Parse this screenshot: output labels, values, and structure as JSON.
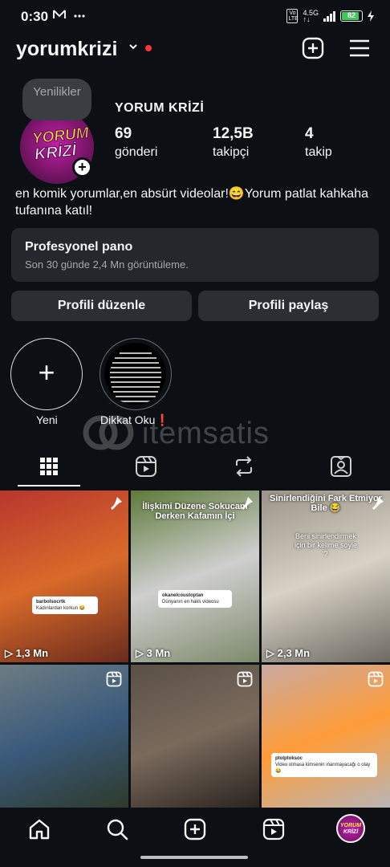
{
  "status_bar": {
    "time": "0:30",
    "network": "4.5G",
    "battery": "82",
    "battery_level": 0.82
  },
  "header": {
    "username": "yorumkrizi"
  },
  "profile": {
    "note": "Yenilikler",
    "display_name": "YORUM KRİZİ",
    "avatar_text_top": "YORUM",
    "avatar_text_bottom": "KRİZİ",
    "stats": [
      {
        "value": "69",
        "label": "gönderi"
      },
      {
        "value": "12,5B",
        "label": "takipçi"
      },
      {
        "value": "4",
        "label": "takip"
      }
    ],
    "bio": "en komik yorumlar,en absürt videolar!😄Yorum patlat kahkaha tufanına katıl!"
  },
  "professional_dashboard": {
    "title": "Profesyonel pano",
    "subtitle": "Son 30 günde 2,4 Mn görüntüleme."
  },
  "actions": {
    "edit_profile": "Profili düzenle",
    "share_profile": "Profili paylaş"
  },
  "highlights": [
    {
      "label": "Yeni",
      "symbol": "+"
    },
    {
      "label": "Dikkat Oku❗"
    }
  ],
  "watermark": {
    "text": "itemsatis"
  },
  "tabs": [
    "posts-grid",
    "reels",
    "reposts",
    "tagged"
  ],
  "grid": [
    {
      "views": "1,3 Mn",
      "comment_user": "barbolsocrtk",
      "comment_text": "Kadınlardan korkun 😂",
      "colors": [
        "#b7362e",
        "#d96a2a",
        "#6a2b1d"
      ]
    },
    {
      "caption": "İlişkimi Düzene Sokucam Derken Kafamın İçi",
      "views": "3 Mn",
      "comment_user": "okanelcoustoptan",
      "comment_text": "Dünyanın en haklı videosu",
      "colors": [
        "#5e7a3a",
        "#cfcfcf",
        "#7d8a6b"
      ]
    },
    {
      "caption": "Sinirlendiğini Fark Etmiyor Bile 😂",
      "overlay_text": "Beni sinirlendirmek için bir kelime söyle ?",
      "views": "2,3 Mn",
      "colors": [
        "#9a9489",
        "#d8d2c6",
        "#6e6a62"
      ]
    },
    {
      "colors": [
        "#6d7c82",
        "#3a5a7c",
        "#2e3a2a"
      ]
    },
    {
      "colors": [
        "#5a5046",
        "#7a6a5c",
        "#2a2420"
      ]
    },
    {
      "comment_user": "ptolptoksoc",
      "comment_text": "Video olmasa kimsenin inanmayacağı o olay 😂",
      "colors": [
        "#c9a9a0",
        "#ff9c3a",
        "#b8b5b5"
      ]
    }
  ]
}
